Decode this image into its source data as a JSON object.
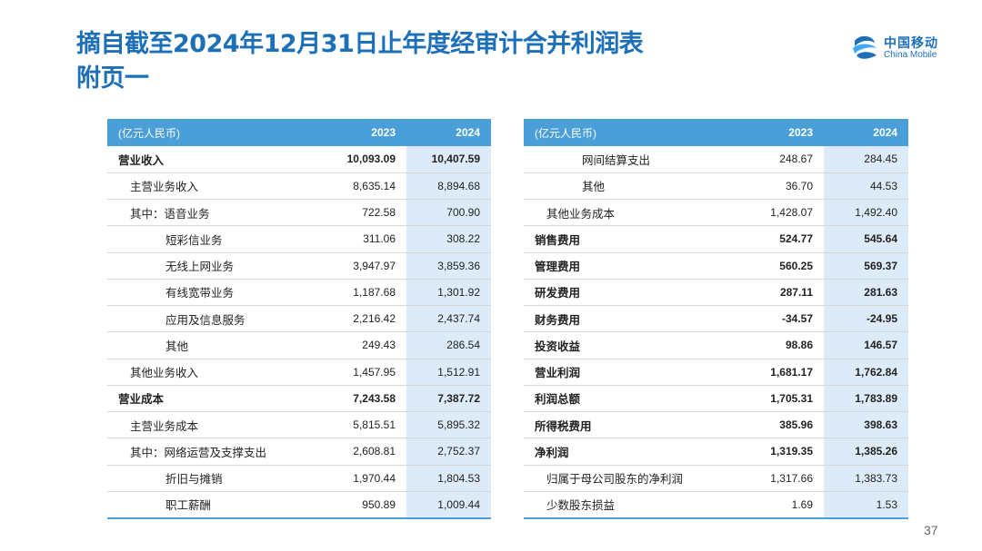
{
  "title": {
    "line1": "摘自截至2024年12月31日止年度经审计合并利润表",
    "line2": "附页一"
  },
  "logo": {
    "cn": "中国移动",
    "en": "China Mobile",
    "color": "#1d6fb8"
  },
  "colors": {
    "header_bg": "#4a9fd8",
    "highlight_col": "#dcebf7",
    "title": "#1d6fb8"
  },
  "left_table": {
    "headers": [
      "(亿元人民币)",
      "2023",
      "2024"
    ],
    "rows": [
      {
        "label": "营业收入",
        "v2023": "10,093.09",
        "v2024": "10,407.59",
        "bold": true,
        "indent": 0
      },
      {
        "label": "主营业务收入",
        "v2023": "8,635.14",
        "v2024": "8,894.68",
        "bold": false,
        "indent": 1
      },
      {
        "label": "其中：语音业务",
        "v2023": "722.58",
        "v2024": "700.90",
        "bold": false,
        "indent": 1
      },
      {
        "label": "短彩信业务",
        "v2023": "311.06",
        "v2024": "308.22",
        "bold": false,
        "indent": 2
      },
      {
        "label": "无线上网业务",
        "v2023": "3,947.97",
        "v2024": "3,859.36",
        "bold": false,
        "indent": 2
      },
      {
        "label": "有线宽带业务",
        "v2023": "1,187.68",
        "v2024": "1,301.92",
        "bold": false,
        "indent": 2
      },
      {
        "label": "应用及信息服务",
        "v2023": "2,216.42",
        "v2024": "2,437.74",
        "bold": false,
        "indent": 2
      },
      {
        "label": "其他",
        "v2023": "249.43",
        "v2024": "286.54",
        "bold": false,
        "indent": 2
      },
      {
        "label": "其他业务收入",
        "v2023": "1,457.95",
        "v2024": "1,512.91",
        "bold": false,
        "indent": 1
      },
      {
        "label": "营业成本",
        "v2023": "7,243.58",
        "v2024": "7,387.72",
        "bold": true,
        "indent": 0
      },
      {
        "label": "主营业务成本",
        "v2023": "5,815.51",
        "v2024": "5,895.32",
        "bold": false,
        "indent": 1
      },
      {
        "label": "其中：网络运营及支撑支出",
        "v2023": "2,608.81",
        "v2024": "2,752.37",
        "bold": false,
        "indent": 1
      },
      {
        "label": "折旧与摊销",
        "v2023": "1,970.44",
        "v2024": "1,804.53",
        "bold": false,
        "indent": 2
      },
      {
        "label": "职工薪酬",
        "v2023": "950.89",
        "v2024": "1,009.44",
        "bold": false,
        "indent": 2
      }
    ]
  },
  "right_table": {
    "headers": [
      "(亿元人民币)",
      "2023",
      "2024"
    ],
    "rows": [
      {
        "label": "网间结算支出",
        "v2023": "248.67",
        "v2024": "284.45",
        "bold": false,
        "indent": 2
      },
      {
        "label": "其他",
        "v2023": "36.70",
        "v2024": "44.53",
        "bold": false,
        "indent": 2
      },
      {
        "label": "其他业务成本",
        "v2023": "1,428.07",
        "v2024": "1,492.40",
        "bold": false,
        "indent": 1
      },
      {
        "label": "销售费用",
        "v2023": "524.77",
        "v2024": "545.64",
        "bold": true,
        "indent": 0
      },
      {
        "label": "管理费用",
        "v2023": "560.25",
        "v2024": "569.37",
        "bold": true,
        "indent": 0
      },
      {
        "label": "研发费用",
        "v2023": "287.11",
        "v2024": "281.63",
        "bold": true,
        "indent": 0
      },
      {
        "label": "财务费用",
        "v2023": "-34.57",
        "v2024": "-24.95",
        "bold": true,
        "indent": 0
      },
      {
        "label": "投资收益",
        "v2023": "98.86",
        "v2024": "146.57",
        "bold": true,
        "indent": 0
      },
      {
        "label": "营业利润",
        "v2023": "1,681.17",
        "v2024": "1,762.84",
        "bold": true,
        "indent": 0
      },
      {
        "label": "利润总额",
        "v2023": "1,705.31",
        "v2024": "1,783.89",
        "bold": true,
        "indent": 0
      },
      {
        "label": "所得税费用",
        "v2023": "385.96",
        "v2024": "398.63",
        "bold": true,
        "indent": 0
      },
      {
        "label": "净利润",
        "v2023": "1,319.35",
        "v2024": "1,385.26",
        "bold": true,
        "indent": 0
      },
      {
        "label": "归属于母公司股东的净利润",
        "v2023": "1,317.66",
        "v2024": "1,383.73",
        "bold": false,
        "indent": 1
      },
      {
        "label": "少数股东损益",
        "v2023": "1.69",
        "v2024": "1.53",
        "bold": false,
        "indent": 1
      }
    ]
  },
  "page_number": "37"
}
